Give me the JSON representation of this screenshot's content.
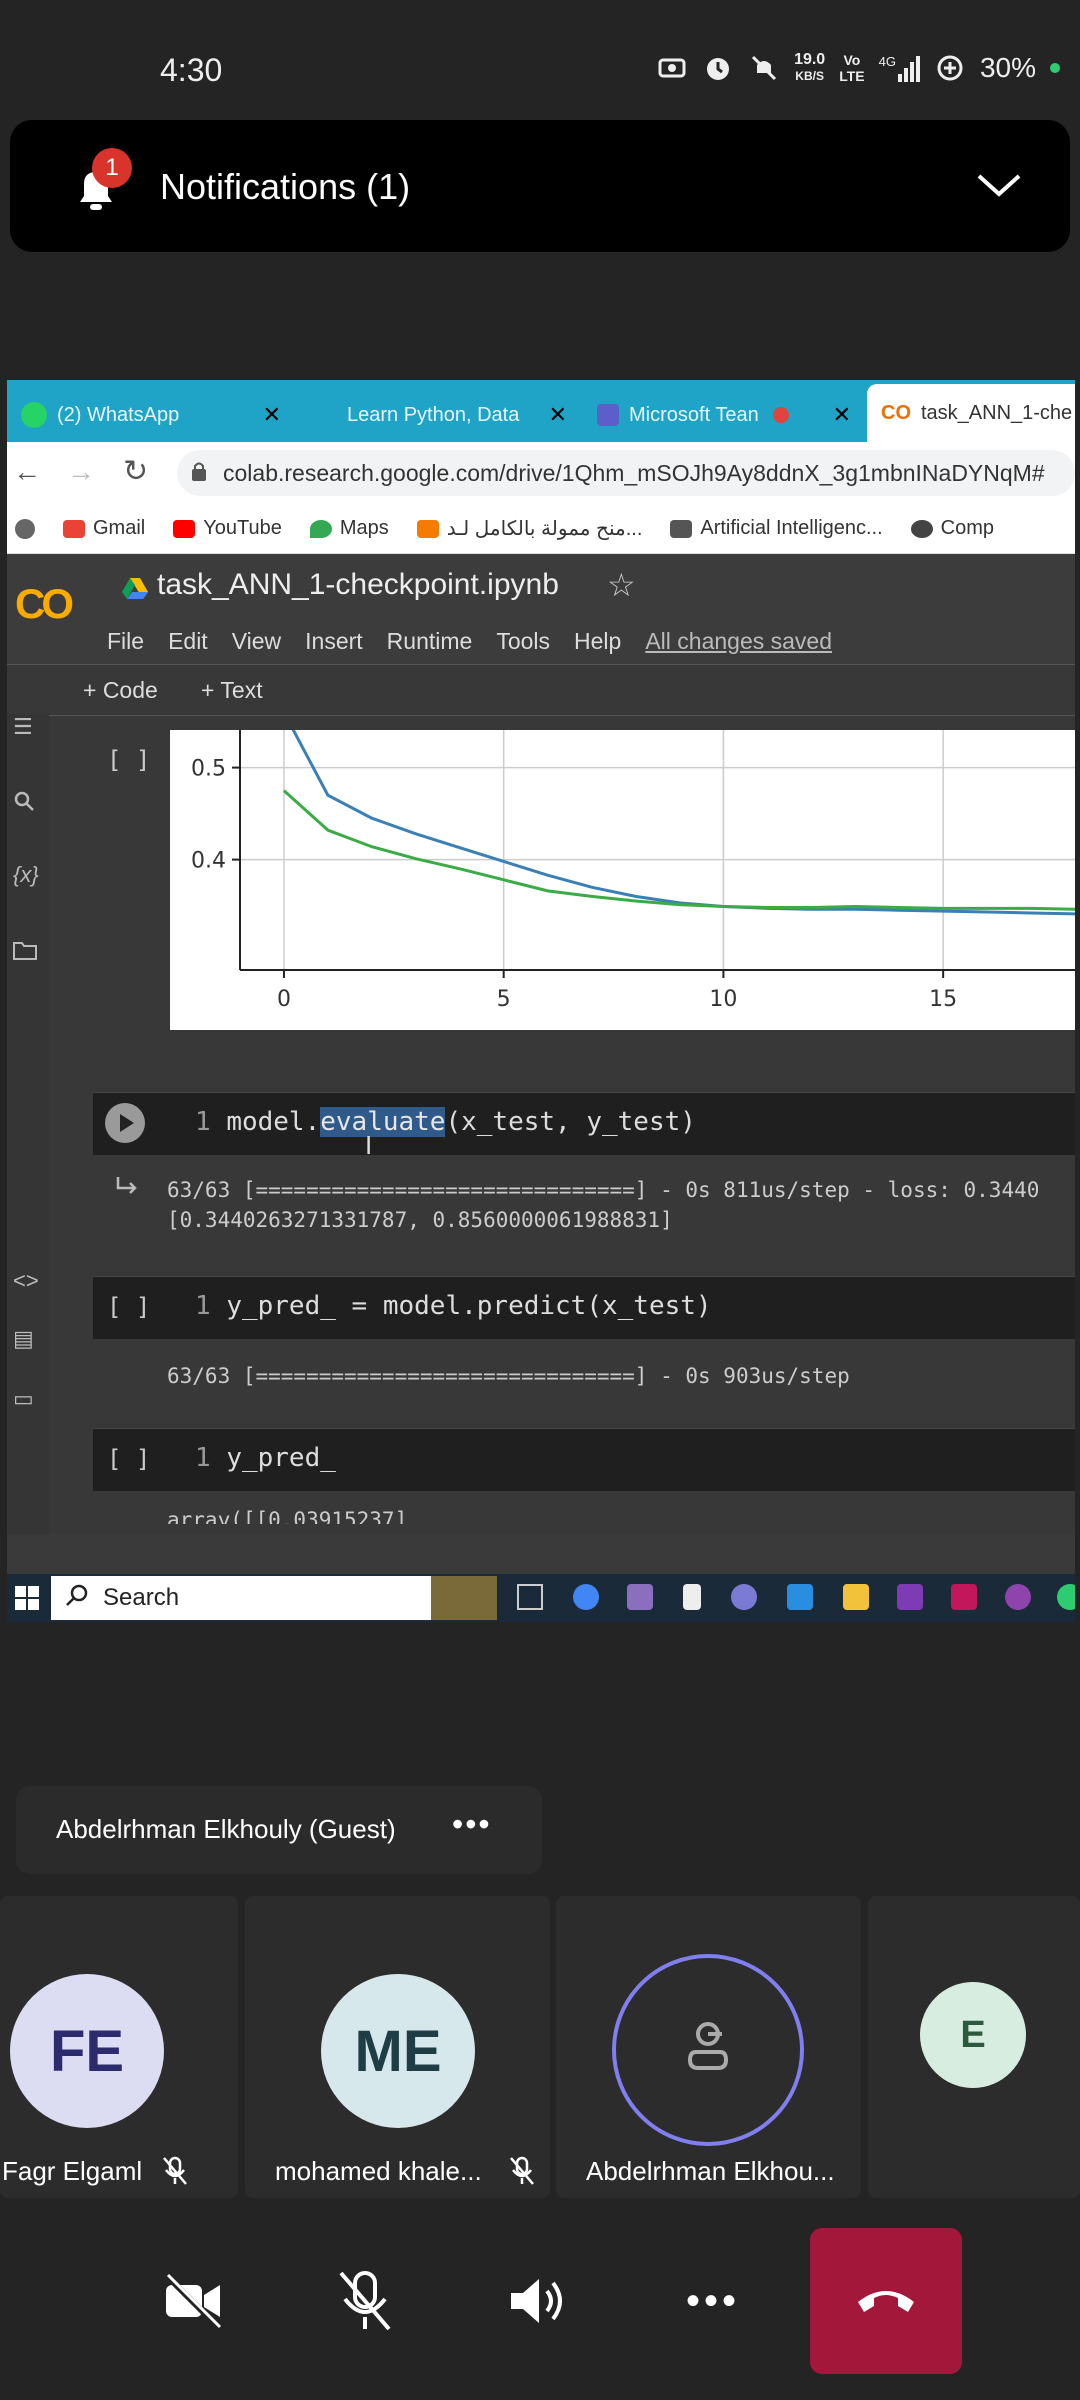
{
  "status_bar": {
    "time": "4:30",
    "net_speed_top": "19.0",
    "net_speed_bottom": "KB/S",
    "volte_top": "Vo",
    "volte_bottom": "LTE",
    "network": "4G",
    "battery": "30%"
  },
  "notification": {
    "badge": "1",
    "label": "Notifications (1)"
  },
  "browser": {
    "tabs": [
      {
        "label": "(2) WhatsApp"
      },
      {
        "label": "Learn Python, Data"
      },
      {
        "label": "Microsoft Tean"
      },
      {
        "label": "task_ANN_1-che"
      }
    ],
    "url": "colab.research.google.com/drive/1Qhm_mSOJh9Ay8ddnX_3g1mbnINaDYNqM#",
    "bookmarks": [
      "Gmail",
      "YouTube",
      "Maps",
      "منح ممولة بالكامل لـد...",
      "Artificial Intelligenc...",
      "Comp"
    ]
  },
  "colab": {
    "logo": "CO",
    "notebook_title": "task_ANN_1-checkpoint.ipynb",
    "menu": [
      "File",
      "Edit",
      "View",
      "Insert",
      "Runtime",
      "Tools",
      "Help"
    ],
    "saved_status": "All changes saved",
    "add_code": "+ Code",
    "add_text": "+ Text",
    "cell_bracket": "[ ]",
    "line_no": "1",
    "cells": [
      {
        "code_prefix": "model.",
        "code_selected": "evaluate",
        "code_suffix": "(x_test, y_test)",
        "output_line1": "63/63 [==============================] - 0s 811us/step - loss: 0.3440",
        "output_line2": "[0.3440263271331787, 0.8560000061988831]"
      },
      {
        "code": "y_pred_ = model.predict(x_test)",
        "output_line1": "63/63 [==============================] - 0s 903us/step"
      },
      {
        "code": "y_pred_",
        "output_line1": "array([[0.03915237]"
      }
    ]
  },
  "chart_data": {
    "type": "line",
    "xlim": [
      -1,
      18
    ],
    "ylim": [
      0.28,
      0.53
    ],
    "xticks": [
      "0",
      "5",
      "10",
      "15"
    ],
    "yticks": [
      "0.4",
      "0.5"
    ],
    "grid": true,
    "series": [
      {
        "color": "#3a7fb5",
        "x": [
          0,
          1,
          2,
          3,
          4,
          5,
          6,
          7,
          8,
          9,
          10,
          11,
          12,
          13,
          14,
          15,
          16,
          17,
          18
        ],
        "values": [
          0.56,
          0.47,
          0.445,
          0.428,
          0.413,
          0.398,
          0.383,
          0.37,
          0.36,
          0.353,
          0.349,
          0.347,
          0.346,
          0.346,
          0.345,
          0.344,
          0.343,
          0.342,
          0.341
        ]
      },
      {
        "color": "#3aab45",
        "x": [
          0,
          1,
          2,
          3,
          4,
          5,
          6,
          7,
          8,
          9,
          10,
          11,
          12,
          13,
          14,
          15,
          16,
          17,
          18
        ],
        "values": [
          0.475,
          0.432,
          0.414,
          0.401,
          0.39,
          0.378,
          0.366,
          0.36,
          0.355,
          0.351,
          0.349,
          0.348,
          0.348,
          0.349,
          0.348,
          0.347,
          0.347,
          0.347,
          0.346
        ]
      }
    ]
  },
  "taskbar": {
    "search_placeholder": "Search"
  },
  "call": {
    "guest_name": "Abdelrhman Elkhouly (Guest)",
    "participants": [
      {
        "initials": "FE",
        "name": "Fagr  Elgaml"
      },
      {
        "initials": "ME",
        "name": "mohamed khale..."
      },
      {
        "initials": "",
        "name": "Abdelrhman Elkhou..."
      },
      {
        "initials": "E",
        "name": ""
      }
    ],
    "colors": {
      "fe_bg": "#dcdcf2",
      "fe_fg": "#2b2b6e",
      "me_bg": "#d7e8ec",
      "me_fg": "#1f3d44",
      "e_bg": "#d6ede0",
      "e_fg": "#2b5a3d",
      "speaker_ring": "#7f7ff0",
      "end_call": "#a3173a"
    }
  }
}
